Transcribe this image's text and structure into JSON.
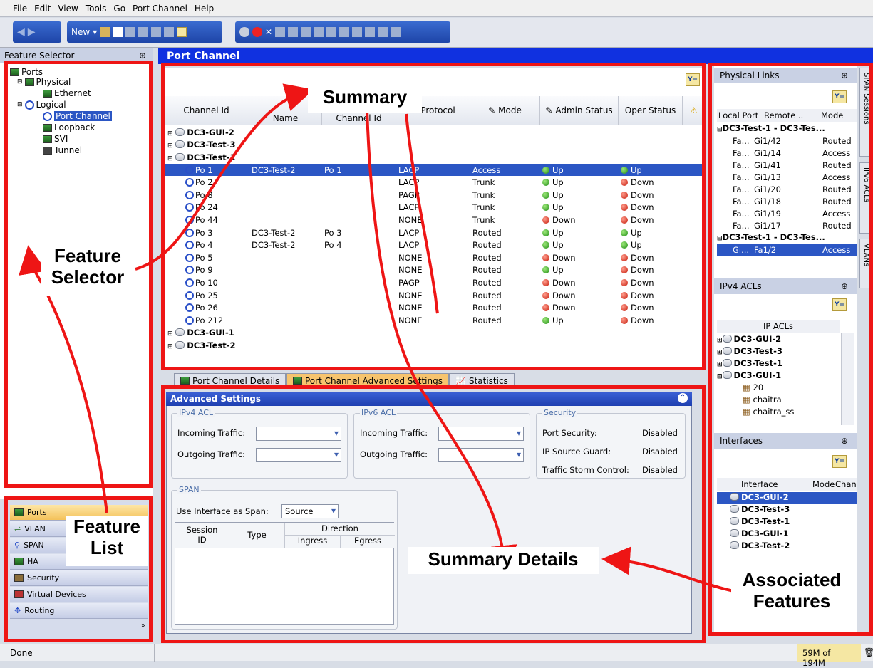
{
  "menu": [
    "File",
    "Edit",
    "View",
    "Tools",
    "Go",
    "Port Channel",
    "Help"
  ],
  "toolbar": {
    "new_label": "New"
  },
  "feature_selector": {
    "title": "Feature Selector",
    "pin": "⊕",
    "tree": [
      "Ports",
      "Physical",
      "Ethernet",
      "Logical",
      "Port Channel",
      "Loopback",
      "SVI",
      "Tunnel"
    ]
  },
  "feature_list": [
    "Ports",
    "VLAN",
    "SPAN",
    "HA",
    "Security",
    "Virtual Devices",
    "Routing"
  ],
  "main": {
    "title": "Port Channel"
  },
  "summary": {
    "columns": [
      "Channel Id",
      "Name",
      "Channel Id",
      "Protocol",
      "Mode",
      "Admin Status",
      "Oper Status"
    ],
    "groups": [
      "DC3-GUI-2",
      "DC3-Test-3",
      "DC3-Test-1",
      "DC3-GUI-1",
      "DC3-Test-2"
    ],
    "rows": [
      {
        "id": "Po 1",
        "name": "DC3-Test-2",
        "chan": "Po 1",
        "proto": "LACP",
        "mode": "Access",
        "admin": "Up",
        "oper": "Up"
      },
      {
        "id": "Po 2",
        "name": "",
        "chan": "",
        "proto": "LACP",
        "mode": "Trunk",
        "admin": "Up",
        "oper": "Down"
      },
      {
        "id": "Po 8",
        "name": "",
        "chan": "",
        "proto": "PAGP",
        "mode": "Trunk",
        "admin": "Up",
        "oper": "Down"
      },
      {
        "id": "Po 24",
        "name": "",
        "chan": "",
        "proto": "LACP",
        "mode": "Trunk",
        "admin": "Up",
        "oper": "Down"
      },
      {
        "id": "Po 44",
        "name": "",
        "chan": "",
        "proto": "NONE",
        "mode": "Trunk",
        "admin": "Down",
        "oper": "Down"
      },
      {
        "id": "Po 3",
        "name": "DC3-Test-2",
        "chan": "Po 3",
        "proto": "LACP",
        "mode": "Routed",
        "admin": "Up",
        "oper": "Up"
      },
      {
        "id": "Po 4",
        "name": "DC3-Test-2",
        "chan": "Po 4",
        "proto": "LACP",
        "mode": "Routed",
        "admin": "Up",
        "oper": "Up"
      },
      {
        "id": "Po 5",
        "name": "",
        "chan": "",
        "proto": "NONE",
        "mode": "Routed",
        "admin": "Down",
        "oper": "Down"
      },
      {
        "id": "Po 9",
        "name": "",
        "chan": "",
        "proto": "NONE",
        "mode": "Routed",
        "admin": "Up",
        "oper": "Down"
      },
      {
        "id": "Po 10",
        "name": "",
        "chan": "",
        "proto": "PAGP",
        "mode": "Routed",
        "admin": "Down",
        "oper": "Down"
      },
      {
        "id": "Po 25",
        "name": "",
        "chan": "",
        "proto": "NONE",
        "mode": "Routed",
        "admin": "Down",
        "oper": "Down"
      },
      {
        "id": "Po 26",
        "name": "",
        "chan": "",
        "proto": "NONE",
        "mode": "Routed",
        "admin": "Down",
        "oper": "Down"
      },
      {
        "id": "Po 212",
        "name": "",
        "chan": "",
        "proto": "NONE",
        "mode": "Routed",
        "admin": "Up",
        "oper": "Down"
      }
    ]
  },
  "tabs": [
    "Port Channel Details",
    "Port Channel Advanced Settings",
    "Statistics"
  ],
  "advanced": {
    "title": "Advanced Settings",
    "ipv4": "IPv4 ACL",
    "ipv6": "IPv6 ACL",
    "incoming": "Incoming Traffic:",
    "outgoing": "Outgoing Traffic:",
    "security": "Security",
    "port_security": "Port Security:",
    "port_security_val": "Disabled",
    "ip_source_guard": "IP Source Guard:",
    "ip_source_guard_val": "Disabled",
    "storm": "Traffic Storm Control:",
    "storm_val": "Disabled",
    "span": "SPAN",
    "use_span": "Use Interface as Span:",
    "span_val": "Source",
    "cols": {
      "session": "Session",
      "id": "ID",
      "type": "Type",
      "direction": "Direction",
      "ingress": "Ingress",
      "egress": "Egress"
    }
  },
  "right": {
    "physical_links": {
      "title": "Physical Links",
      "cols": [
        "Local Port",
        "Remote ..",
        "Mode"
      ],
      "group1": "DC3-Test-1 - DC3-Tes...",
      "group2": "DC3-Test-1 - DC3-Tes...",
      "rows": [
        {
          "l": "Fa...",
          "r": "Gi1/42",
          "m": "Routed"
        },
        {
          "l": "Fa...",
          "r": "Gi1/14",
          "m": "Access"
        },
        {
          "l": "Fa...",
          "r": "Gi1/41",
          "m": "Routed"
        },
        {
          "l": "Fa...",
          "r": "Gi1/13",
          "m": "Access"
        },
        {
          "l": "Fa...",
          "r": "Gi1/20",
          "m": "Routed"
        },
        {
          "l": "Fa...",
          "r": "Gi1/18",
          "m": "Routed"
        },
        {
          "l": "Fa...",
          "r": "Gi1/19",
          "m": "Access"
        },
        {
          "l": "Fa...",
          "r": "Gi1/17",
          "m": "Routed"
        }
      ],
      "sel": {
        "l": "Gi...",
        "r": "Fa1/2",
        "m": "Access"
      }
    },
    "ipv4_acls": {
      "title": "IPv4 ACLs",
      "col": "IP ACLs",
      "groups": [
        "DC3-GUI-2",
        "DC3-Test-3",
        "DC3-Test-1",
        "DC3-GUI-1"
      ],
      "items": [
        "20",
        "chaitra",
        "chaitra_ss"
      ]
    },
    "interfaces": {
      "title": "Interfaces",
      "cols": [
        "Interface",
        "Mode",
        "Chan"
      ],
      "items": [
        "DC3-GUI-2",
        "DC3-Test-3",
        "DC3-Test-1",
        "DC3-GUI-1",
        "DC3-Test-2"
      ]
    },
    "vtabs": [
      "SPAN Sessions",
      "IPv6 ACLs",
      "VLANs"
    ]
  },
  "status": {
    "text": "Done",
    "memory": "59M of 194M"
  },
  "annotations": {
    "summary": "Summary",
    "feature_selector": "Feature Selector",
    "feature_list": "Feature List",
    "summary_details": "Summary Details",
    "associated": "Associated Features"
  },
  "colors": {
    "accent": "#1031e0",
    "highlight": "#ee1515",
    "selection": "#2b56c4"
  }
}
